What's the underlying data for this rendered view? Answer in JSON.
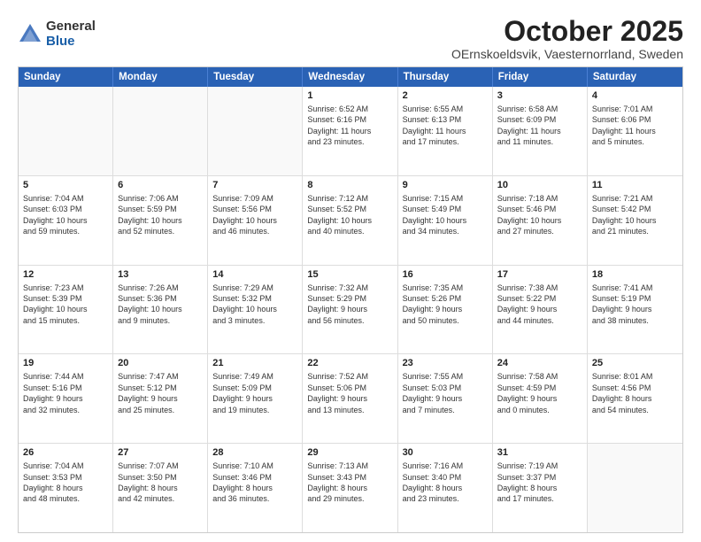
{
  "header": {
    "logo_general": "General",
    "logo_blue": "Blue",
    "month_title": "October 2025",
    "location": "OErnskoeldsvik, Vaesternorrland, Sweden"
  },
  "weekdays": [
    "Sunday",
    "Monday",
    "Tuesday",
    "Wednesday",
    "Thursday",
    "Friday",
    "Saturday"
  ],
  "rows": [
    [
      {
        "day": "",
        "text": ""
      },
      {
        "day": "",
        "text": ""
      },
      {
        "day": "",
        "text": ""
      },
      {
        "day": "1",
        "text": "Sunrise: 6:52 AM\nSunset: 6:16 PM\nDaylight: 11 hours\nand 23 minutes."
      },
      {
        "day": "2",
        "text": "Sunrise: 6:55 AM\nSunset: 6:13 PM\nDaylight: 11 hours\nand 17 minutes."
      },
      {
        "day": "3",
        "text": "Sunrise: 6:58 AM\nSunset: 6:09 PM\nDaylight: 11 hours\nand 11 minutes."
      },
      {
        "day": "4",
        "text": "Sunrise: 7:01 AM\nSunset: 6:06 PM\nDaylight: 11 hours\nand 5 minutes."
      }
    ],
    [
      {
        "day": "5",
        "text": "Sunrise: 7:04 AM\nSunset: 6:03 PM\nDaylight: 10 hours\nand 59 minutes."
      },
      {
        "day": "6",
        "text": "Sunrise: 7:06 AM\nSunset: 5:59 PM\nDaylight: 10 hours\nand 52 minutes."
      },
      {
        "day": "7",
        "text": "Sunrise: 7:09 AM\nSunset: 5:56 PM\nDaylight: 10 hours\nand 46 minutes."
      },
      {
        "day": "8",
        "text": "Sunrise: 7:12 AM\nSunset: 5:52 PM\nDaylight: 10 hours\nand 40 minutes."
      },
      {
        "day": "9",
        "text": "Sunrise: 7:15 AM\nSunset: 5:49 PM\nDaylight: 10 hours\nand 34 minutes."
      },
      {
        "day": "10",
        "text": "Sunrise: 7:18 AM\nSunset: 5:46 PM\nDaylight: 10 hours\nand 27 minutes."
      },
      {
        "day": "11",
        "text": "Sunrise: 7:21 AM\nSunset: 5:42 PM\nDaylight: 10 hours\nand 21 minutes."
      }
    ],
    [
      {
        "day": "12",
        "text": "Sunrise: 7:23 AM\nSunset: 5:39 PM\nDaylight: 10 hours\nand 15 minutes."
      },
      {
        "day": "13",
        "text": "Sunrise: 7:26 AM\nSunset: 5:36 PM\nDaylight: 10 hours\nand 9 minutes."
      },
      {
        "day": "14",
        "text": "Sunrise: 7:29 AM\nSunset: 5:32 PM\nDaylight: 10 hours\nand 3 minutes."
      },
      {
        "day": "15",
        "text": "Sunrise: 7:32 AM\nSunset: 5:29 PM\nDaylight: 9 hours\nand 56 minutes."
      },
      {
        "day": "16",
        "text": "Sunrise: 7:35 AM\nSunset: 5:26 PM\nDaylight: 9 hours\nand 50 minutes."
      },
      {
        "day": "17",
        "text": "Sunrise: 7:38 AM\nSunset: 5:22 PM\nDaylight: 9 hours\nand 44 minutes."
      },
      {
        "day": "18",
        "text": "Sunrise: 7:41 AM\nSunset: 5:19 PM\nDaylight: 9 hours\nand 38 minutes."
      }
    ],
    [
      {
        "day": "19",
        "text": "Sunrise: 7:44 AM\nSunset: 5:16 PM\nDaylight: 9 hours\nand 32 minutes."
      },
      {
        "day": "20",
        "text": "Sunrise: 7:47 AM\nSunset: 5:12 PM\nDaylight: 9 hours\nand 25 minutes."
      },
      {
        "day": "21",
        "text": "Sunrise: 7:49 AM\nSunset: 5:09 PM\nDaylight: 9 hours\nand 19 minutes."
      },
      {
        "day": "22",
        "text": "Sunrise: 7:52 AM\nSunset: 5:06 PM\nDaylight: 9 hours\nand 13 minutes."
      },
      {
        "day": "23",
        "text": "Sunrise: 7:55 AM\nSunset: 5:03 PM\nDaylight: 9 hours\nand 7 minutes."
      },
      {
        "day": "24",
        "text": "Sunrise: 7:58 AM\nSunset: 4:59 PM\nDaylight: 9 hours\nand 0 minutes."
      },
      {
        "day": "25",
        "text": "Sunrise: 8:01 AM\nSunset: 4:56 PM\nDaylight: 8 hours\nand 54 minutes."
      }
    ],
    [
      {
        "day": "26",
        "text": "Sunrise: 7:04 AM\nSunset: 3:53 PM\nDaylight: 8 hours\nand 48 minutes."
      },
      {
        "day": "27",
        "text": "Sunrise: 7:07 AM\nSunset: 3:50 PM\nDaylight: 8 hours\nand 42 minutes."
      },
      {
        "day": "28",
        "text": "Sunrise: 7:10 AM\nSunset: 3:46 PM\nDaylight: 8 hours\nand 36 minutes."
      },
      {
        "day": "29",
        "text": "Sunrise: 7:13 AM\nSunset: 3:43 PM\nDaylight: 8 hours\nand 29 minutes."
      },
      {
        "day": "30",
        "text": "Sunrise: 7:16 AM\nSunset: 3:40 PM\nDaylight: 8 hours\nand 23 minutes."
      },
      {
        "day": "31",
        "text": "Sunrise: 7:19 AM\nSunset: 3:37 PM\nDaylight: 8 hours\nand 17 minutes."
      },
      {
        "day": "",
        "text": ""
      }
    ]
  ]
}
